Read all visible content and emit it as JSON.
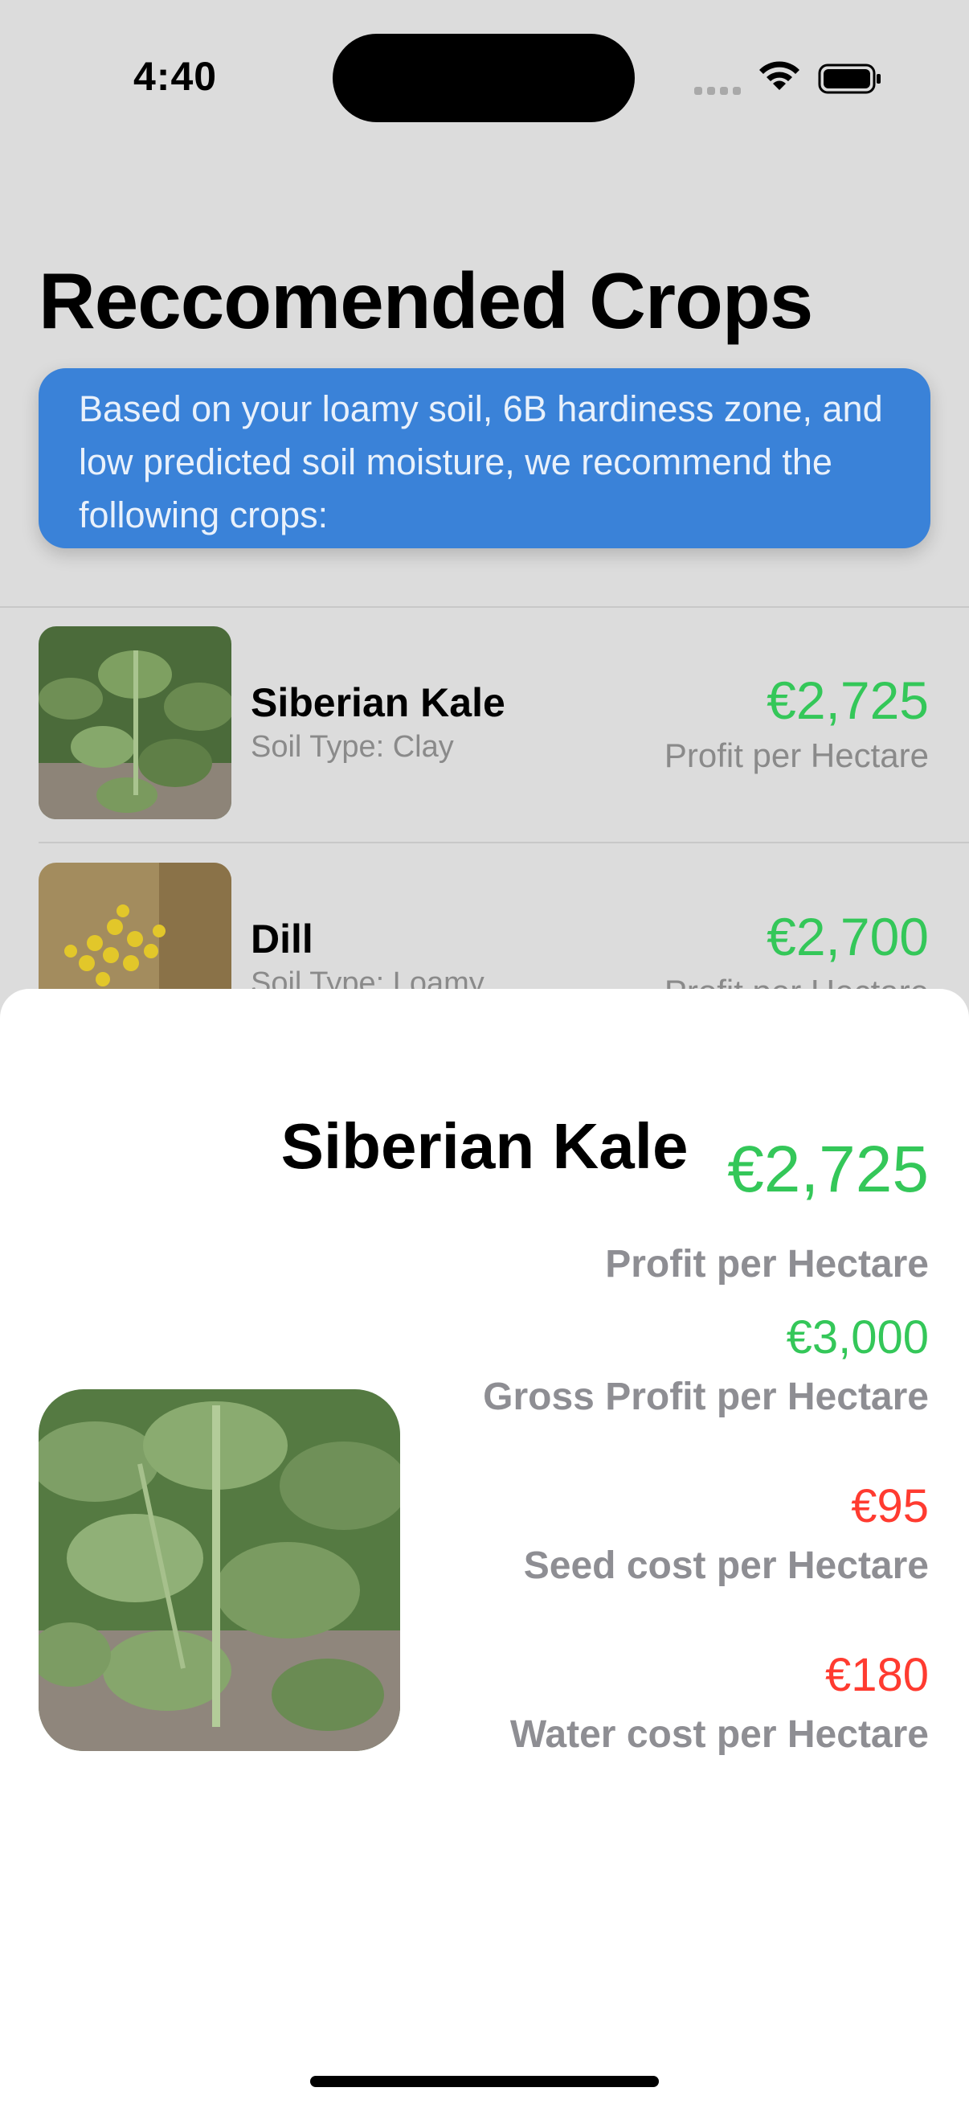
{
  "status_bar": {
    "time": "4:40"
  },
  "page": {
    "title": "Reccomended Crops"
  },
  "info_card": {
    "text": "Based on your loamy soil, 6B hardiness zone, and low predicted soil moisture, we recommend the following crops:"
  },
  "crops": [
    {
      "name": "Siberian Kale",
      "soil": "Soil Type: Clay",
      "profit": "€2,725",
      "profit_label": "Profit per Hectare"
    },
    {
      "name": "Dill",
      "soil": "Soil Type: Loamy",
      "profit": "€2,700",
      "profit_label": "Profit per Hectare"
    }
  ],
  "detail_sheet": {
    "title": "Siberian Kale",
    "metrics": [
      {
        "value": "€2,725",
        "label": "Profit per Hectare",
        "color": "#34c759"
      },
      {
        "value": "€3,000",
        "label": "Gross Profit per Hectare",
        "color": "#34c759"
      },
      {
        "value": "€95",
        "label": "Seed cost per Hectare",
        "color": "#ff3b30"
      },
      {
        "value": "€180",
        "label": "Water cost per Hectare",
        "color": "#ff3b30"
      }
    ]
  },
  "colors": {
    "accent_blue": "#3a82d8",
    "profit_green": "#34c759",
    "cost_red": "#ff3b30"
  }
}
